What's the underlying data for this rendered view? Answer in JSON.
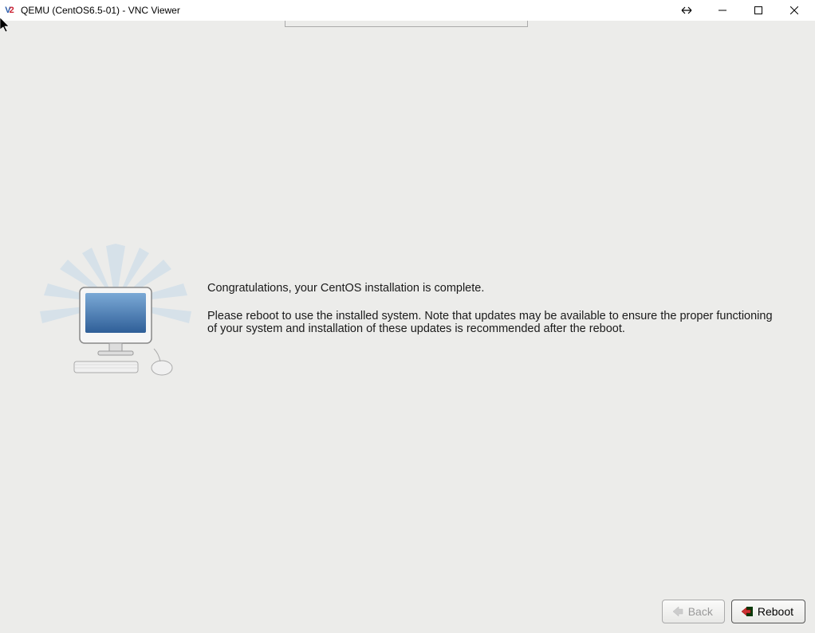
{
  "window": {
    "title": "QEMU (CentOS6.5-01) - VNC Viewer"
  },
  "installer": {
    "heading": "Congratulations, your CentOS installation is complete.",
    "body": "Please reboot to use the installed system.  Note that updates may be available to ensure the proper functioning of your system and installation of these updates is recommended after the reboot."
  },
  "buttons": {
    "back": "Back",
    "reboot": "Reboot"
  }
}
